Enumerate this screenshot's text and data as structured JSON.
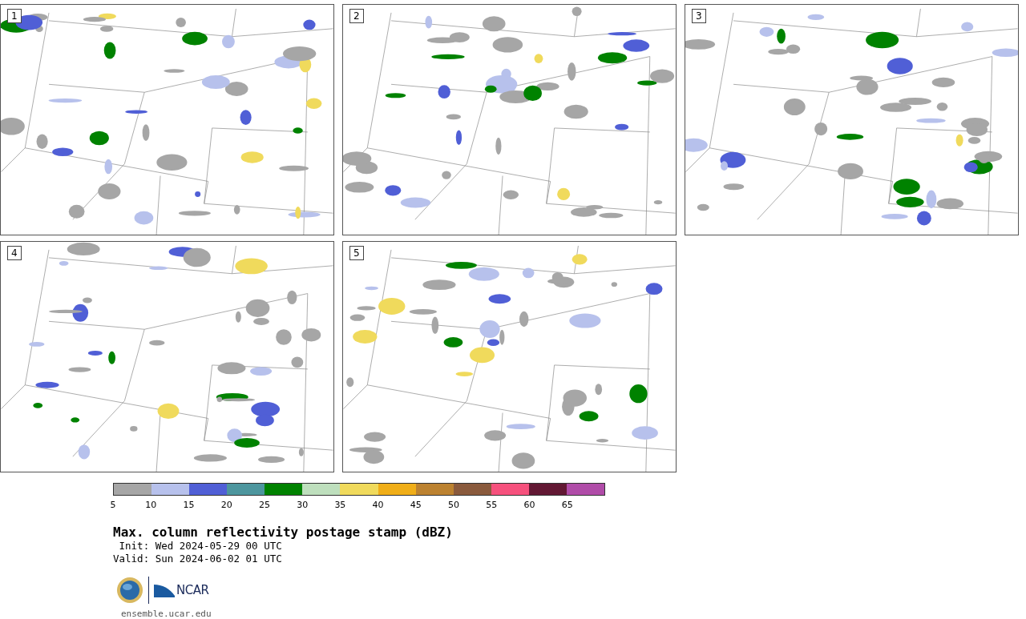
{
  "panels": [
    {
      "label": "1"
    },
    {
      "label": "2"
    },
    {
      "label": "3"
    },
    {
      "label": "4"
    },
    {
      "label": "5"
    }
  ],
  "legend": {
    "bins": [
      {
        "color": "#a6a6a6"
      },
      {
        "color": "#b7c1ec"
      },
      {
        "color": "#505fd6"
      },
      {
        "color": "#4d969e"
      },
      {
        "color": "#008200"
      },
      {
        "color": "#bedfbd"
      },
      {
        "color": "#f0da5c"
      },
      {
        "color": "#f0ae18"
      },
      {
        "color": "#bc8230"
      },
      {
        "color": "#8a5a3d"
      },
      {
        "color": "#f6517d"
      },
      {
        "color": "#621833"
      },
      {
        "color": "#b04ca8"
      }
    ],
    "ticks": [
      "5",
      "10",
      "15",
      "20",
      "25",
      "30",
      "35",
      "40",
      "45",
      "50",
      "55",
      "60",
      "65"
    ]
  },
  "title": "Max. column reflectivity postage stamp (dBZ)",
  "init": " Init: Wed 2024-05-29 00 UTC",
  "valid": "Valid: Sun 2024-06-02 01 UTC",
  "logo_text": "NCAR",
  "site": "ensemble.ucar.edu"
}
